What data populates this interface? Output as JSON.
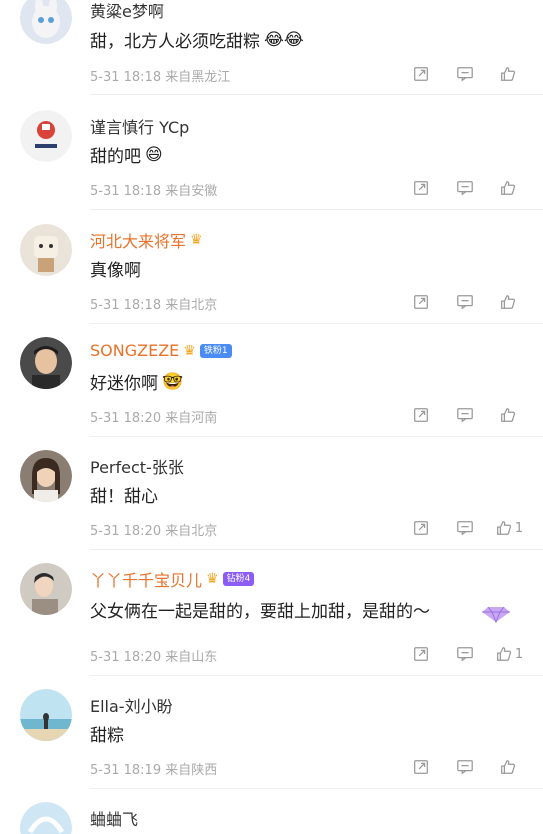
{
  "comments": [
    {
      "username": "黄粱e梦啊",
      "text": "甜，北方人必须吃甜粽",
      "emoji": "😂😂",
      "date": "5-31 18:18",
      "location": "来自黑龙江",
      "likes": ""
    },
    {
      "username": "谨言慎行 YCp",
      "text": "甜的吧",
      "emoji": "😄",
      "date": "5-31 18:18",
      "location": "来自安徽",
      "likes": ""
    },
    {
      "username": "河北大来将军",
      "text": "真像啊",
      "emoji": "",
      "date": "5-31 18:18",
      "location": "来自北京",
      "likes": ""
    },
    {
      "username": "SONGZEZE",
      "badge": "铁粉1",
      "text": "好迷你啊",
      "emoji": "🤓",
      "date": "5-31 18:20",
      "location": "来自河南",
      "likes": ""
    },
    {
      "username": "Perfect-张张",
      "text": "甜！甜心",
      "emoji": "",
      "date": "5-31 18:20",
      "location": "来自北京",
      "likes": "1"
    },
    {
      "username": "丫丫千千宝贝儿",
      "badge": "钻粉4",
      "text": "父女俩在一起是甜的，要甜上加甜，是甜的～",
      "emoji": "",
      "date": "5-31 18:20",
      "location": "来自山东",
      "likes": "1"
    },
    {
      "username": "Ella-刘小盼",
      "text": "甜粽",
      "emoji": "",
      "date": "5-31 18:19",
      "location": "来自陕西",
      "likes": ""
    },
    {
      "username": "蛐蛐飞"
    }
  ],
  "colors": {
    "vip_name": "#e8722a",
    "meta": "#aaaaaa",
    "icon": "#999999"
  }
}
